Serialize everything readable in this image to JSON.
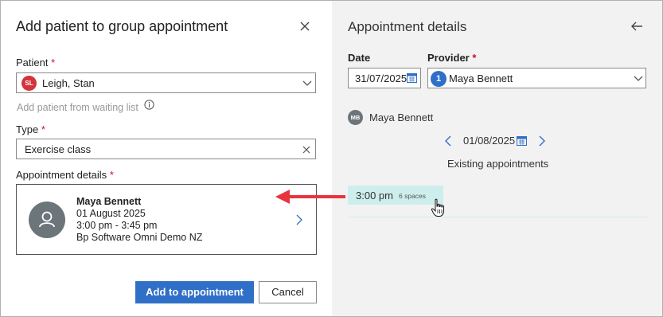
{
  "dialog": {
    "title": "Add patient to group appointment",
    "patient_label": "Patient",
    "required_mark": "*",
    "patient_initials": "SL",
    "patient_value": "Leigh, Stan",
    "waiting_list_link": "Add patient from waiting list",
    "type_label": "Type",
    "type_value": "Exercise class",
    "appt_details_label": "Appointment details",
    "card": {
      "name": "Maya Bennett",
      "date": "01 August 2025",
      "time": "3:00 pm - 3:45 pm",
      "location": "Bp Software Omni Demo NZ"
    },
    "add_button": "Add to appointment",
    "cancel_button": "Cancel"
  },
  "details": {
    "title": "Appointment details",
    "date_label": "Date",
    "date_value": "31/07/2025",
    "provider_label": "Provider",
    "provider_badge": "1",
    "provider_value": "Maya Bennett",
    "provider_initials": "MB",
    "provider_name": "Maya Bennett",
    "nav_date": "01/08/2025",
    "existing_label": "Existing appointments",
    "slot": {
      "time": "3:00 pm",
      "spaces": "6 spaces"
    }
  },
  "colors": {
    "primary": "#2f6fc7",
    "required": "#c8102e",
    "patient_avatar": "#d3343c",
    "slot_bg": "#cdeeed",
    "annotation_arrow": "#e8343c"
  },
  "icons": [
    "close-icon",
    "chevron-down-icon",
    "info-icon",
    "clear-icon",
    "person-icon",
    "chevron-right-icon",
    "back-arrow-icon",
    "calendar-icon",
    "chevron-left-icon",
    "hand-cursor-icon",
    "red-arrow-annotation"
  ]
}
